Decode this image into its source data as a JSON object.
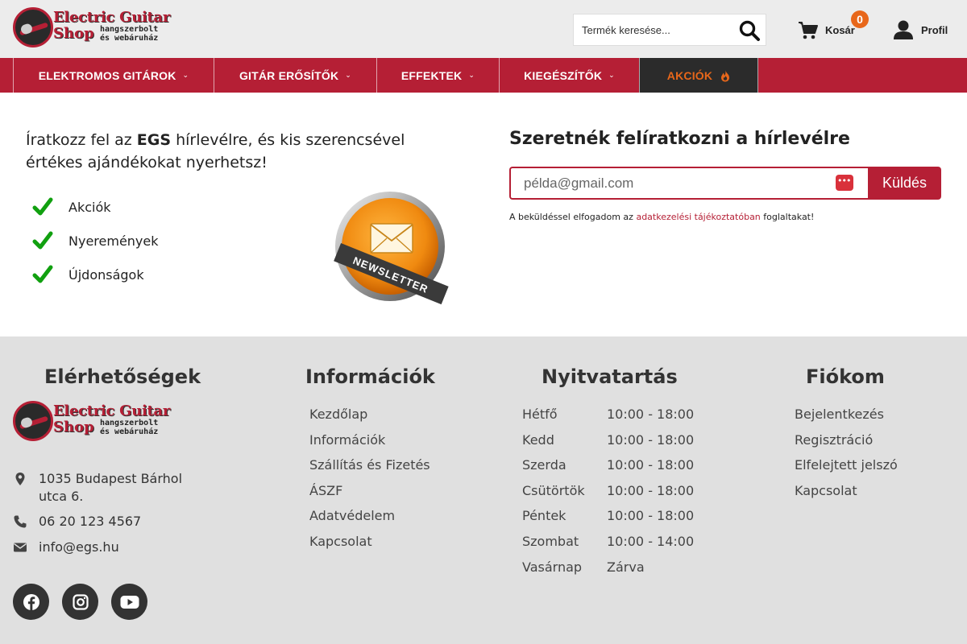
{
  "header": {
    "logo": {
      "title_line1": "Electric Guitar",
      "title_line2": "Shop",
      "sub_line1": "hangszerbolt",
      "sub_line2": "és webáruház"
    },
    "search": {
      "placeholder": "Termék keresése..."
    },
    "cart": {
      "label": "Kosár",
      "count": "0"
    },
    "profile": {
      "label": "Profil"
    }
  },
  "nav": {
    "items": [
      {
        "label": "ELEKTROMOS GITÁROK"
      },
      {
        "label": "GITÁR ERŐSÍTŐK"
      },
      {
        "label": "EFFEKTEK"
      },
      {
        "label": "KIEGÉSZÍTŐK"
      },
      {
        "label": "AKCIÓK"
      }
    ],
    "sale_color": "#e8671a",
    "accent": "#b51f35"
  },
  "newsletter": {
    "intro_prefix": "Íratkozz fel az ",
    "intro_brand": "EGS",
    "intro_suffix": " hírlevélre, és kis szerencsével értékes ajándékokat nyerhetsz!",
    "benefits": [
      "Akciók",
      "Nyeremények",
      "Újdonságok"
    ],
    "badge_text": "NEWSLETTER",
    "title": "Szeretnék felíratkozni a hírlevélre",
    "email_placeholder": "példa@gmail.com",
    "submit_label": "Küldés",
    "consent_prefix": "A beküldéssel elfogadom az ",
    "consent_link": "adatkezelési tájékoztatóban",
    "consent_suffix": " foglaltakat!"
  },
  "footer": {
    "contact": {
      "title": "Elérhetőségek",
      "address": "1035 Budapest Bárhol utca 6.",
      "phone": "06 20 123 4567",
      "email": "info@egs.hu"
    },
    "info": {
      "title": "Információk",
      "links": [
        "Kezdőlap",
        "Információk",
        "Szállítás és Fizetés",
        "ÁSZF",
        "Adatvédelem",
        "Kapcsolat"
      ]
    },
    "hours": {
      "title": "Nyitvatartás",
      "rows": [
        {
          "day": "Hétfő",
          "time": "10:00 - 18:00"
        },
        {
          "day": "Kedd",
          "time": "10:00 - 18:00"
        },
        {
          "day": "Szerda",
          "time": "10:00 - 18:00"
        },
        {
          "day": "Csütörtök",
          "time": "10:00 - 18:00"
        },
        {
          "day": "Péntek",
          "time": "10:00 - 18:00"
        },
        {
          "day": "Szombat",
          "time": "10:00 - 14:00"
        },
        {
          "day": "Vasárnap",
          "time": "Zárva"
        }
      ]
    },
    "account": {
      "title": "Fiókom",
      "links": [
        "Bejelentkezés",
        "Regisztráció",
        "Elfelejtett jelszó",
        "Kapcsolat"
      ]
    },
    "social": [
      "facebook-icon",
      "instagram-icon",
      "youtube-icon"
    ]
  }
}
